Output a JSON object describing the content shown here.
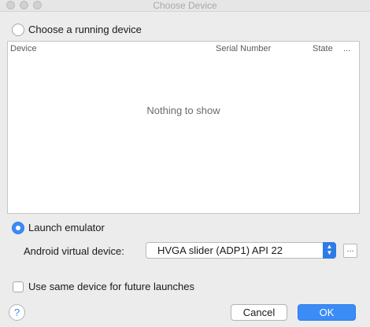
{
  "window": {
    "title": "Choose Device",
    "colors": {
      "accent": "#3b8cf6",
      "background": "#ececec"
    }
  },
  "running_device": {
    "label": "Choose a running device",
    "selected": false,
    "table": {
      "columns": [
        "Device",
        "Serial Number",
        "State",
        "..."
      ],
      "empty_text": "Nothing to show"
    }
  },
  "emulator": {
    "label": "Launch emulator",
    "selected": true,
    "avd_label": "Android virtual device:",
    "avd_selected": "HVGA slider (ADP1) API 22",
    "more_label": "..."
  },
  "same_device": {
    "label": "Use same device for future launches",
    "checked": false
  },
  "footer": {
    "help_label": "?",
    "cancel_label": "Cancel",
    "ok_label": "OK"
  }
}
